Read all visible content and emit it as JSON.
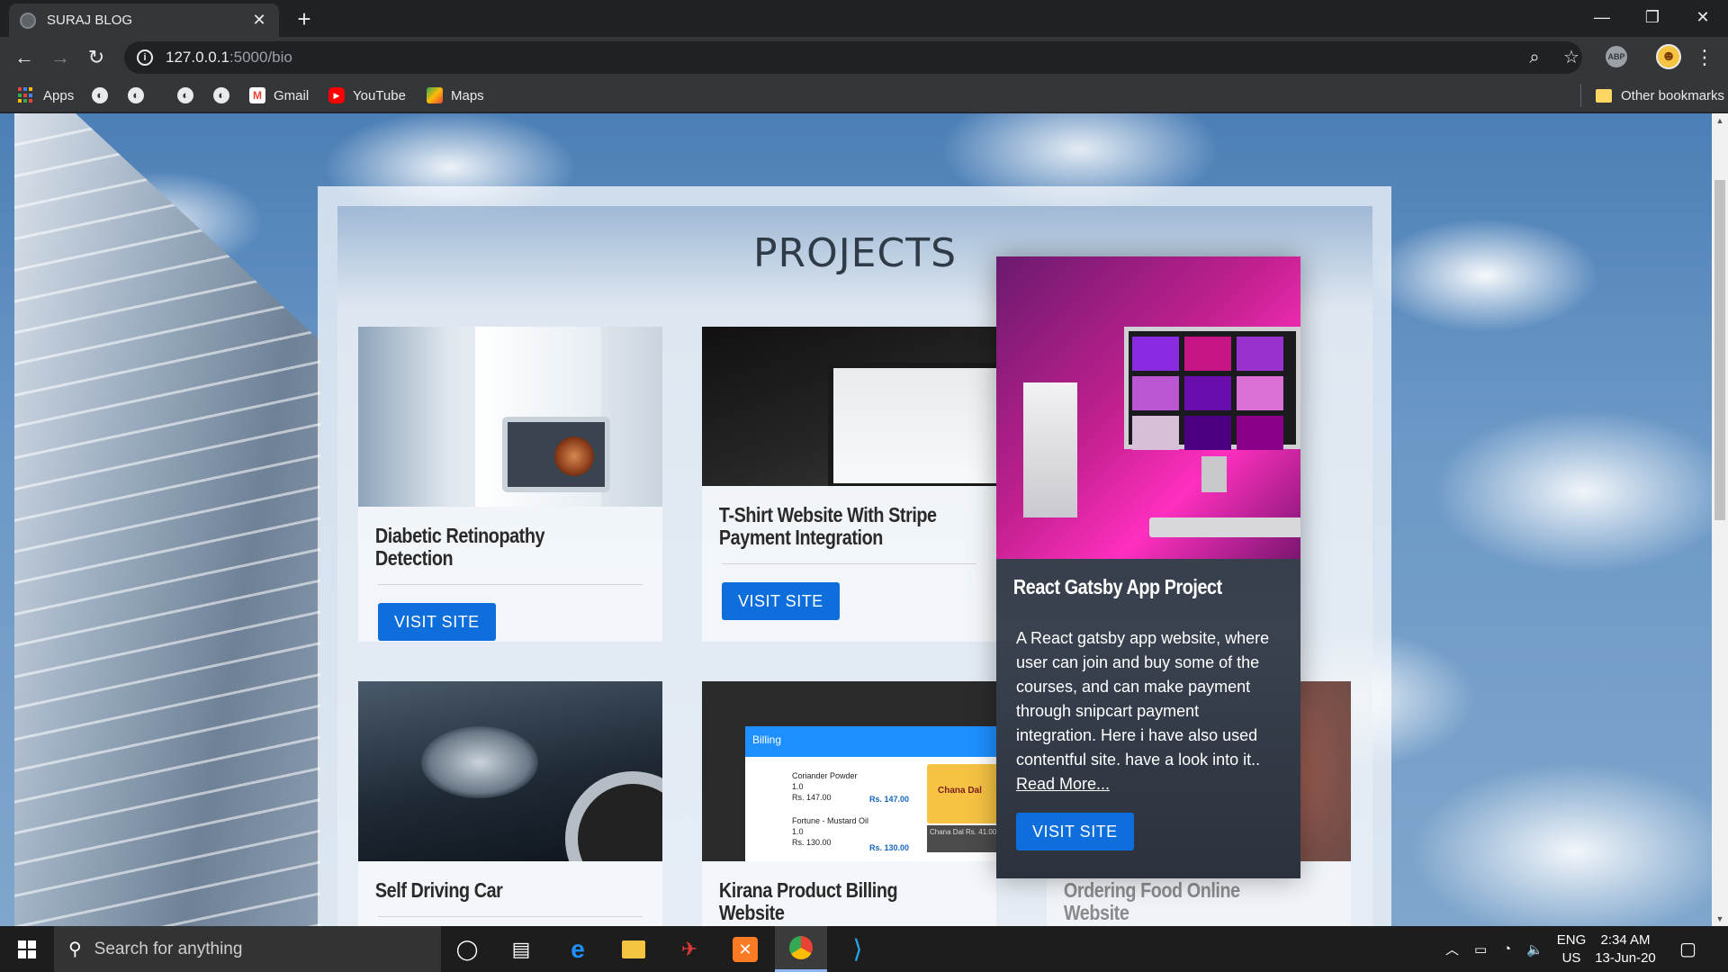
{
  "browser": {
    "tab_title": "SURAJ BLOG",
    "tab_close": "✕",
    "new_tab": "+",
    "url_host": "127.0.0.1",
    "url_path": ":5000/bio",
    "window_controls": {
      "minimize": "—",
      "restore": "❐",
      "close": "✕"
    },
    "nav": {
      "back": "←",
      "forward": "→",
      "reload": "↻"
    },
    "zoom_icon": "⌕",
    "star_icon": "☆",
    "abp_label": "ABP",
    "profile_glyph": "☻",
    "menu": "⋮"
  },
  "bookmarks": {
    "apps": "Apps",
    "gmail": "Gmail",
    "youtube": "YouTube",
    "maps": "Maps",
    "other": "Other bookmarks"
  },
  "page": {
    "section_title": "PROJECTS",
    "projects": [
      {
        "title": "Diabetic Retinopathy Detection",
        "button": "VISIT SITE"
      },
      {
        "title": "T-Shirt Website With Stripe Payment Integration",
        "button": "VISIT SITE"
      },
      {
        "title": "Self Driving Car"
      },
      {
        "title": "Kirana Product Billing Website"
      },
      {
        "title": "Ordering Food Online Website"
      }
    ],
    "featured": {
      "title": "React Gatsby App Project",
      "description": "A React gatsby app website, where user can join and buy some of the courses, and can make payment through snipcart payment integration. Here i have also used contentful site. have a look into it..",
      "read_more": "Read More...",
      "button": "VISIT SITE"
    },
    "billing_thumb": {
      "header": "Billing",
      "item1_name": "Coriander Powder",
      "item1_qty": "1.0",
      "item1_price": "Rs. 147.00",
      "item1_total": "Rs. 147.00",
      "item2_name": "Fortune - Mustard Oil",
      "item2_qty": "1.0",
      "item2_price": "Rs. 130.00",
      "item2_total": "Rs. 130.00",
      "tag": "Chana Dal",
      "tag2": "Chana Dal\nRs. 41.00"
    },
    "accent_color": "#0d6edc"
  },
  "taskbar": {
    "search_placeholder": "Search for anything",
    "lang_line1": "ENG",
    "lang_line2": "US",
    "time": "2:34 AM",
    "date": "13-Jun-20"
  }
}
